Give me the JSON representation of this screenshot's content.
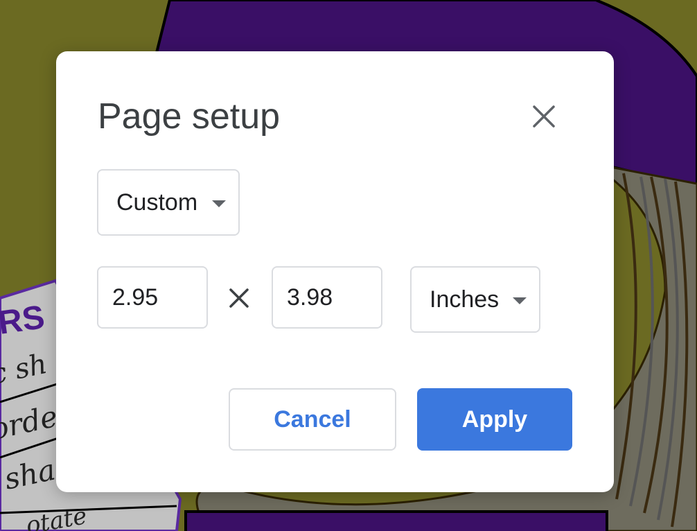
{
  "dialog": {
    "title": "Page setup",
    "close_icon": "close-icon",
    "preset_select": {
      "value": "Custom",
      "icon": "caret-down-icon"
    },
    "width_value": "2.95",
    "dimension_separator_icon": "times-icon",
    "height_value": "3.98",
    "units_select": {
      "value": "Inches",
      "icon": "caret-down-icon"
    },
    "cancel_label": "Cancel",
    "apply_label": "Apply"
  },
  "background": {
    "partial_texts": [
      "RS",
      "c sh",
      "orde",
      "sha",
      "otate"
    ]
  },
  "colors": {
    "accent": "#3b78de",
    "title_text": "#3c4043",
    "border": "#dadce0",
    "bg_olive": "#6b6a22",
    "bg_purple": "#3a0f66"
  }
}
